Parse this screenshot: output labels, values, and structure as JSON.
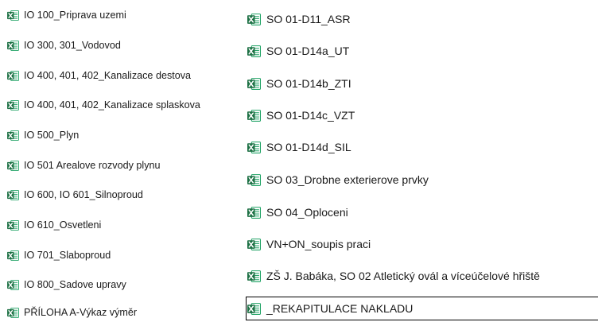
{
  "file_icon": "excel-file-icon",
  "colors": {
    "excel_green": "#1e7145",
    "excel_light": "#21a366",
    "focus_outline": "#000000"
  },
  "left_files": [
    {
      "name": "IO 100_Priprava uzemi"
    },
    {
      "name": "IO 300, 301_Vodovod"
    },
    {
      "name": "IO 400, 401, 402_Kanalizace destova"
    },
    {
      "name": "IO 400, 401, 402_Kanalizace splaskova"
    },
    {
      "name": "IO 500_Plyn"
    },
    {
      "name": "IO 501 Arealove rozvody plynu"
    },
    {
      "name": "IO 600, IO 601_Silnoproud"
    },
    {
      "name": "IO 610_Osvetleni"
    },
    {
      "name": "IO 701_Slaboproud"
    },
    {
      "name": "IO 800_Sadove upravy"
    },
    {
      "name": "PŘÍLOHA A-Výkaz výměr"
    }
  ],
  "right_files": [
    {
      "name": "SO 01-D11_ASR"
    },
    {
      "name": "SO 01-D14a_UT"
    },
    {
      "name": "SO 01-D14b_ZTI"
    },
    {
      "name": "SO 01-D14c_VZT"
    },
    {
      "name": "SO 01-D14d_SIL"
    },
    {
      "name": "SO 03_Drobne exterierove prvky"
    },
    {
      "name": "SO 04_Oploceni"
    },
    {
      "name": "VN+ON_soupis praci"
    },
    {
      "name": "ZŠ J. Babáka, SO 02 Atletický ovál a víceúčelové hřiště"
    },
    {
      "name": "_REKAPITULACE NAKLADU",
      "focused": true
    }
  ]
}
